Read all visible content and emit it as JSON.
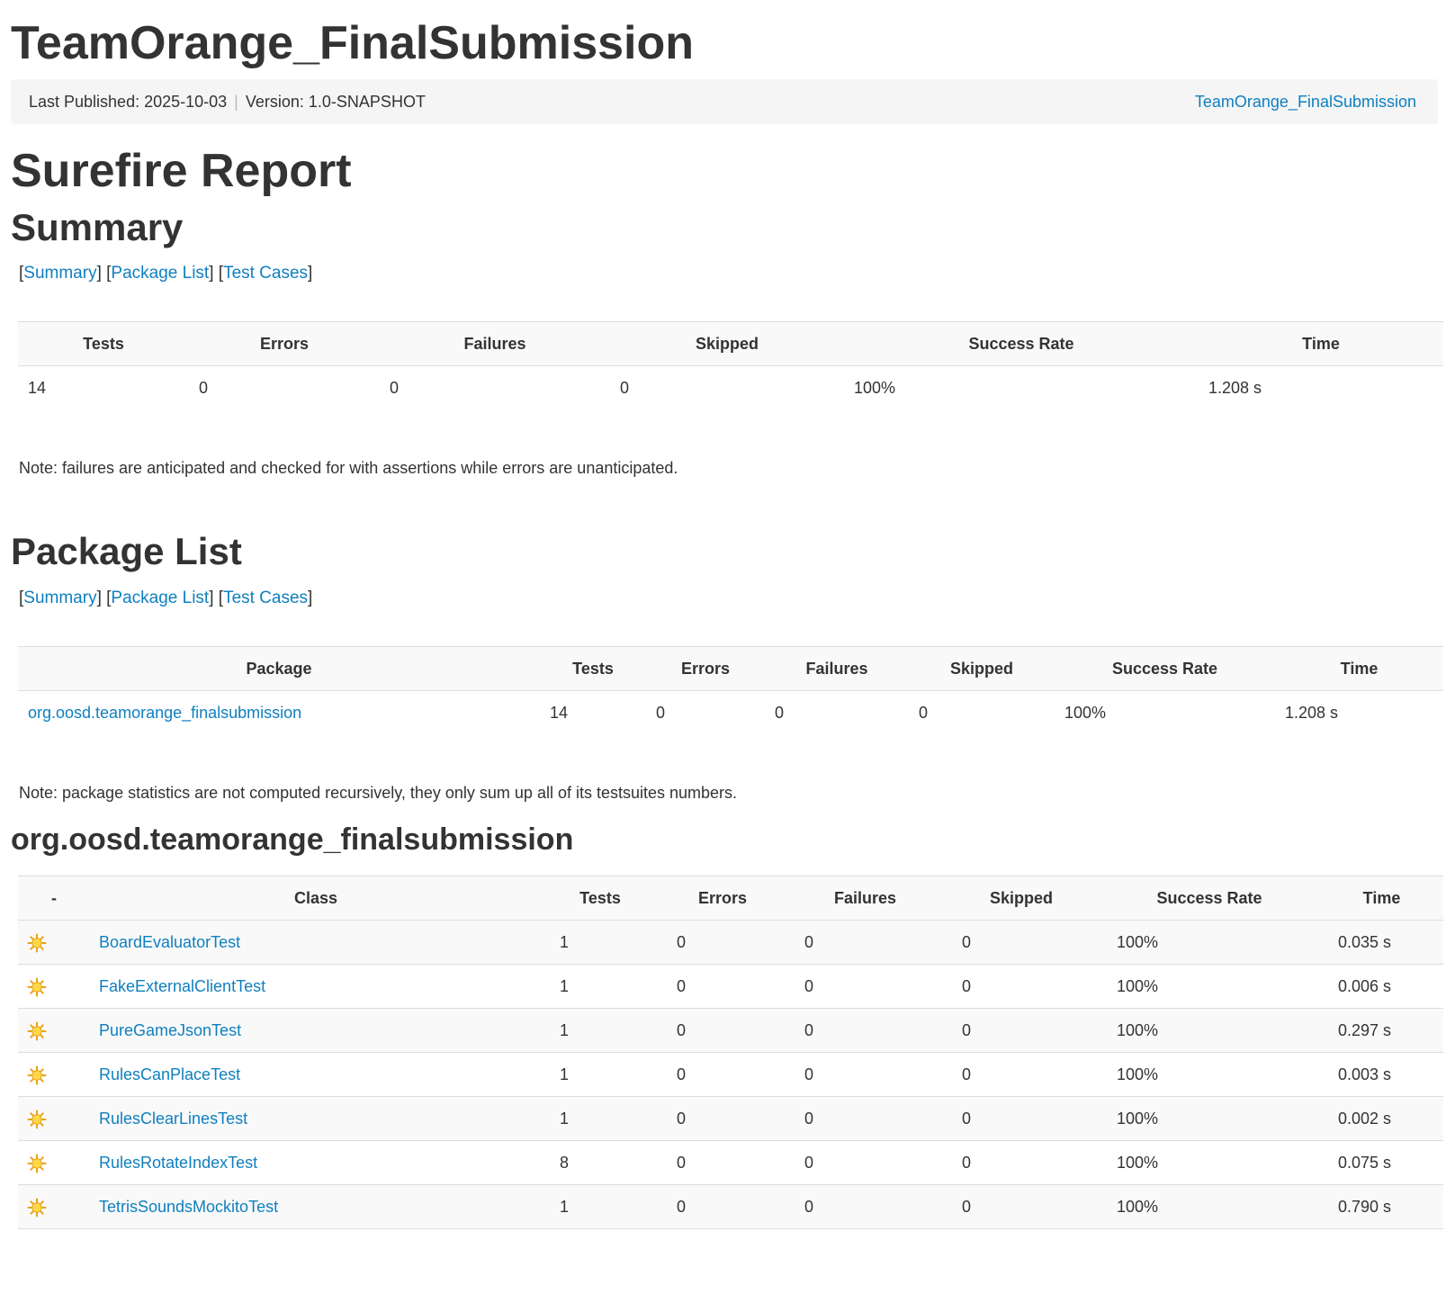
{
  "header": {
    "project_title": "TeamOrange_FinalSubmission",
    "last_published": "Last Published: 2025-10-03",
    "separator": "|",
    "version": "Version: 1.0-SNAPSHOT",
    "project_link": "TeamOrange_FinalSubmission"
  },
  "report_title": "Surefire Report",
  "nav": {
    "summary": "Summary",
    "package_list": "Package List",
    "test_cases": "Test Cases"
  },
  "summary": {
    "heading": "Summary",
    "columns": [
      "Tests",
      "Errors",
      "Failures",
      "Skipped",
      "Success Rate",
      "Time"
    ],
    "row": {
      "tests": "14",
      "errors": "0",
      "failures": "0",
      "skipped": "0",
      "success_rate": "100%",
      "time": "1.208 s"
    },
    "note": "Note: failures are anticipated and checked for with assertions while errors are unanticipated."
  },
  "package_list": {
    "heading": "Package List",
    "columns": [
      "Package",
      "Tests",
      "Errors",
      "Failures",
      "Skipped",
      "Success Rate",
      "Time"
    ],
    "row": {
      "package": "org.oosd.teamorange_finalsubmission",
      "tests": "14",
      "errors": "0",
      "failures": "0",
      "skipped": "0",
      "success_rate": "100%",
      "time": "1.208 s"
    },
    "note": "Note: package statistics are not computed recursively, they only sum up all of its testsuites numbers."
  },
  "package_detail": {
    "heading": "org.oosd.teamorange_finalsubmission",
    "columns": [
      "-",
      "Class",
      "Tests",
      "Errors",
      "Failures",
      "Skipped",
      "Success Rate",
      "Time"
    ],
    "icon": "success-sun-icon",
    "rows": [
      {
        "class": "BoardEvaluatorTest",
        "tests": "1",
        "errors": "0",
        "failures": "0",
        "skipped": "0",
        "success_rate": "100%",
        "time": "0.035 s"
      },
      {
        "class": "FakeExternalClientTest",
        "tests": "1",
        "errors": "0",
        "failures": "0",
        "skipped": "0",
        "success_rate": "100%",
        "time": "0.006 s"
      },
      {
        "class": "PureGameJsonTest",
        "tests": "1",
        "errors": "0",
        "failures": "0",
        "skipped": "0",
        "success_rate": "100%",
        "time": "0.297 s"
      },
      {
        "class": "RulesCanPlaceTest",
        "tests": "1",
        "errors": "0",
        "failures": "0",
        "skipped": "0",
        "success_rate": "100%",
        "time": "0.003 s"
      },
      {
        "class": "RulesClearLinesTest",
        "tests": "1",
        "errors": "0",
        "failures": "0",
        "skipped": "0",
        "success_rate": "100%",
        "time": "0.002 s"
      },
      {
        "class": "RulesRotateIndexTest",
        "tests": "8",
        "errors": "0",
        "failures": "0",
        "skipped": "0",
        "success_rate": "100%",
        "time": "0.075 s"
      },
      {
        "class": "TetrisSoundsMockitoTest",
        "tests": "1",
        "errors": "0",
        "failures": "0",
        "skipped": "0",
        "success_rate": "100%",
        "time": "0.790 s"
      }
    ]
  },
  "colors": {
    "link": "#0f7fbf",
    "text": "#333333",
    "bar_bg": "#f5f5f5",
    "row_alt": "#f9f9f9"
  }
}
